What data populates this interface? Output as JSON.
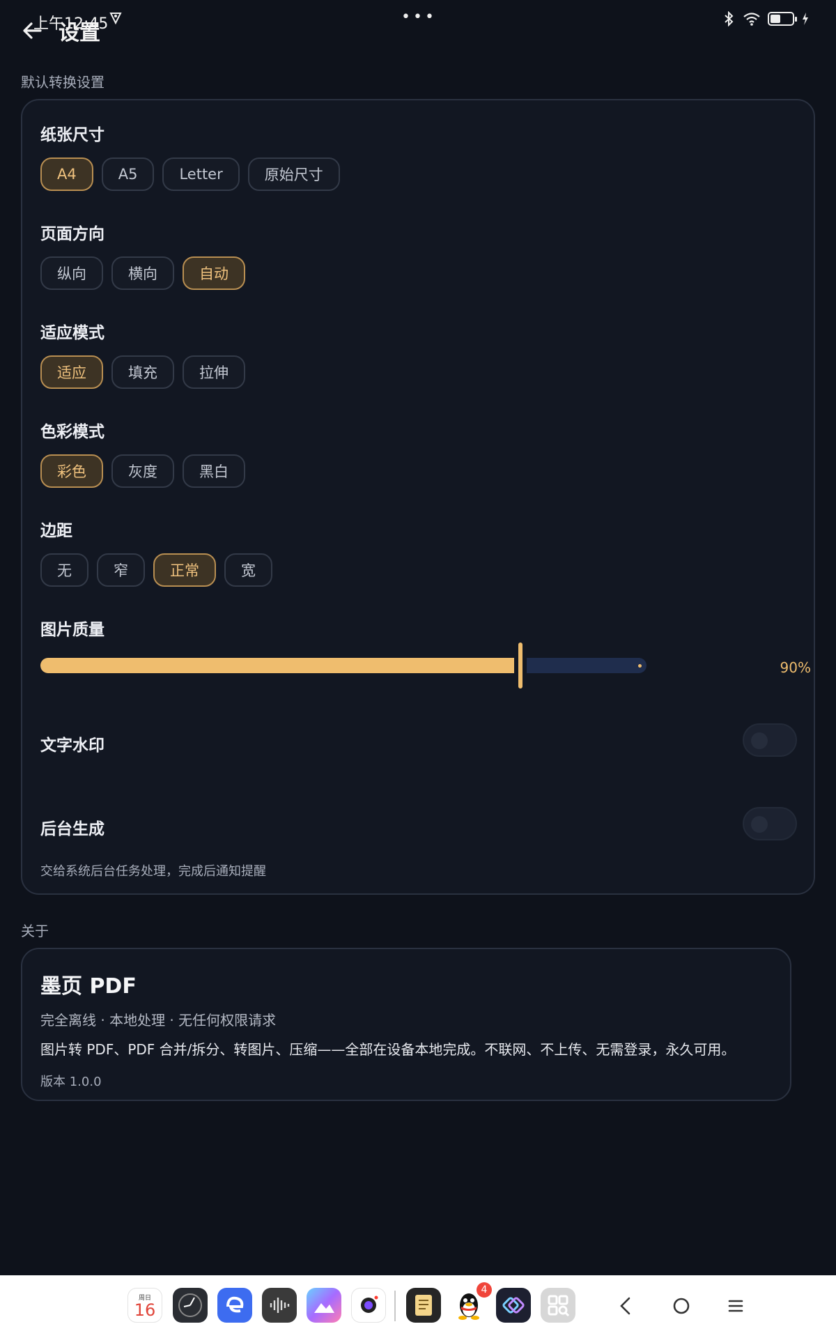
{
  "status_bar": {
    "time": "上午12:45",
    "battery_level": 0.45
  },
  "header": {
    "title": "设置"
  },
  "sections": {
    "default_label": "默认转换设置",
    "about_label": "关于"
  },
  "paper_size": {
    "title": "纸张尺寸",
    "options": [
      "A4",
      "A5",
      "Letter",
      "原始尺寸"
    ],
    "selected": "A4"
  },
  "orientation": {
    "title": "页面方向",
    "options": [
      "纵向",
      "横向",
      "自动"
    ],
    "selected": "自动"
  },
  "fit_mode": {
    "title": "适应模式",
    "options": [
      "适应",
      "填充",
      "拉伸"
    ],
    "selected": "适应"
  },
  "color_mode": {
    "title": "色彩模式",
    "options": [
      "彩色",
      "灰度",
      "黑白"
    ],
    "selected": "彩色"
  },
  "margin": {
    "title": "边距",
    "options": [
      "无",
      "窄",
      "正常",
      "宽"
    ],
    "selected": "正常"
  },
  "image_quality": {
    "title": "图片质量",
    "value": 0.9,
    "value_label": "90%"
  },
  "watermark": {
    "label": "文字水印",
    "enabled": false
  },
  "background_gen": {
    "label": "后台生成",
    "enabled": false,
    "description": "交给系统后台任务处理，完成后通知提醒"
  },
  "about": {
    "app_name": "墨页 PDF",
    "tags": "完全离线 · 本地处理 · 无任何权限请求",
    "description": "图片转 PDF、PDF 合并/拆分、转图片、压缩——全部在设备本地完成。不联网、不上传、无需登录，永久可用。",
    "version": "版本 1.0.0"
  },
  "dock": {
    "calendar_weekday": "周日",
    "calendar_day": "16",
    "qq_badge": "4",
    "apps": [
      "calendar-icon",
      "clock-icon",
      "browser-icon",
      "recorder-icon",
      "gallery-icon",
      "camera-icon",
      "notes-icon",
      "qq-icon",
      "shortcuts-icon",
      "scanner-icon"
    ]
  }
}
